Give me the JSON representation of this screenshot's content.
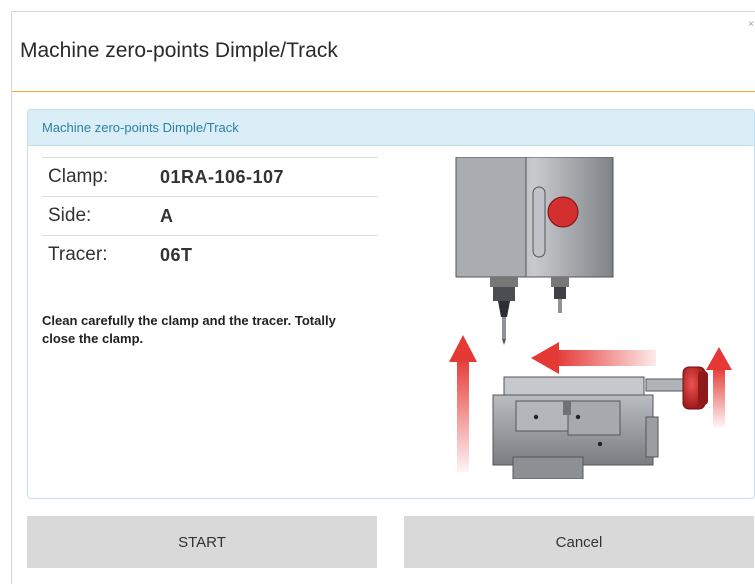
{
  "dialog": {
    "title": "Machine zero-points Dimple/Track",
    "close_icon": "×"
  },
  "panel": {
    "header": "Machine zero-points Dimple/Track",
    "rows": [
      {
        "label": "Clamp:",
        "value": "01RA-106-107"
      },
      {
        "label": "Side:",
        "value": "A"
      },
      {
        "label": "Tracer:",
        "value": "06T"
      }
    ],
    "instruction": "Clean carefully the clamp and the tracer. Totally close the clamp.",
    "illustration_icon": "machine-clamp-tracer-illustration"
  },
  "actions": {
    "start_label": "START",
    "cancel_label": "Cancel"
  },
  "colors": {
    "title_rule": "#f0a830",
    "panel_header_bg": "#d9eef7",
    "panel_header_text": "#2f7fa6",
    "button_bg": "#d9d9d9",
    "arrow_red": "#e53935",
    "knob_red": "#c62828"
  }
}
